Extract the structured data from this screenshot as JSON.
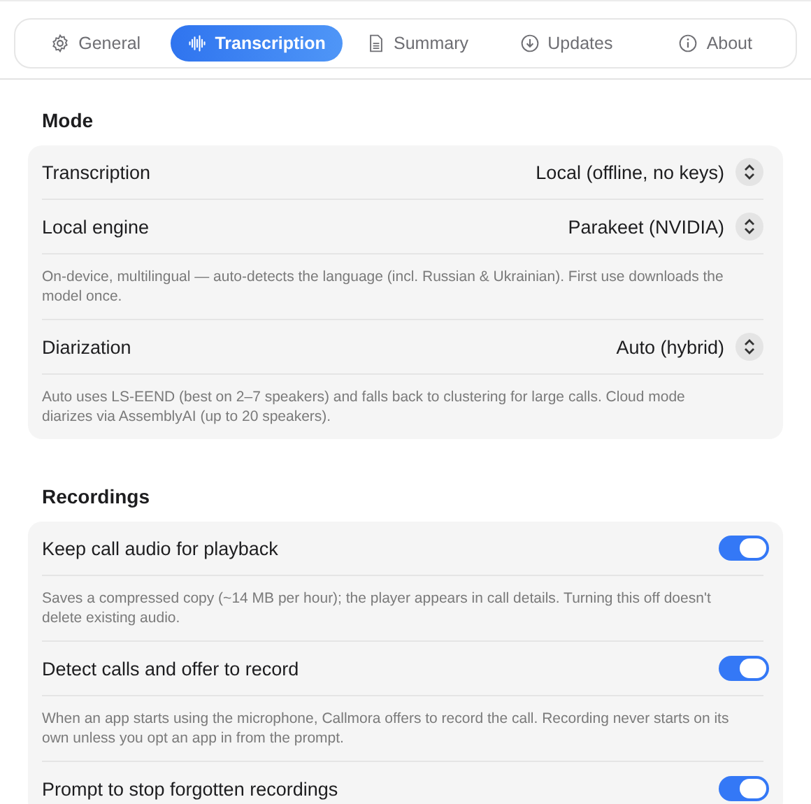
{
  "tabs": [
    {
      "label": "General",
      "selected": false
    },
    {
      "label": "Transcription",
      "selected": true
    },
    {
      "label": "Summary",
      "selected": false
    },
    {
      "label": "Updates",
      "selected": false
    },
    {
      "label": "About",
      "selected": false
    }
  ],
  "sections": [
    {
      "title": "Mode",
      "items": [
        {
          "kind": "select",
          "label": "Transcription",
          "value": "Local (offline, no keys)"
        },
        {
          "kind": "select",
          "label": "Local engine",
          "value": "Parakeet (NVIDIA)"
        },
        {
          "kind": "note",
          "text": "On-device, multilingual — auto-detects the language (incl. Russian & Ukrainian). First use downloads the model once."
        },
        {
          "kind": "select",
          "label": "Diarization",
          "value": "Auto (hybrid)"
        },
        {
          "kind": "note",
          "text": "Auto uses LS-EEND (best on 2–7 speakers) and falls back to clustering for large calls. Cloud mode diarizes via AssemblyAI (up to 20 speakers)."
        }
      ]
    },
    {
      "title": "Recordings",
      "items": [
        {
          "kind": "toggle",
          "label": "Keep call audio for playback",
          "on": true
        },
        {
          "kind": "note",
          "text": "Saves a compressed copy (~14 MB per hour); the player appears in call details. Turning this off doesn't delete existing audio."
        },
        {
          "kind": "toggle",
          "label": "Detect calls and offer to record",
          "on": true
        },
        {
          "kind": "note",
          "text": "When an app starts using the microphone, Callmora offers to record the call. Recording never starts on its own unless you opt an app in from the prompt."
        },
        {
          "kind": "toggle",
          "label": "Prompt to stop forgotten recordings",
          "on": true
        }
      ]
    }
  ]
}
